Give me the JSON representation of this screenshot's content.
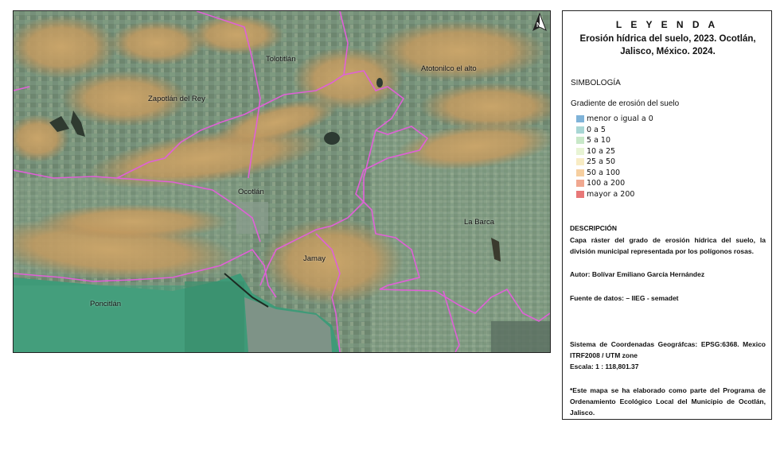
{
  "map": {
    "labels": {
      "tolotitlan": "Tolotitlán",
      "atotonilco": "Atotonilco el alto",
      "zapotlan": "Zapotlán del Rey",
      "ocotlan": "Ocotlán",
      "la_barca": "La Barca",
      "jamay": "Jamay",
      "poncitlan": "Poncitlán"
    },
    "north_arrow_label": "N",
    "boundary_color": "#e060d8"
  },
  "legend": {
    "heading": "L E Y E N D A",
    "title": "Erosión hídrica del suelo, 2023.  Ocotlán, Jalisco, México.  2024.",
    "simbologia": "SIMBOLOGÍA",
    "gradient_title": "Gradiente de erosión del suelo",
    "classes": [
      {
        "label": "menor o igual a 0",
        "color": "#7fb3d8"
      },
      {
        "label": "0 a 5",
        "color": "#a8d6d4"
      },
      {
        "label": "5 a 10",
        "color": "#c8e8c8"
      },
      {
        "label": "10 a 25",
        "color": "#e8f4d4"
      },
      {
        "label": "25 a 50",
        "color": "#f8ecc4"
      },
      {
        "label": "50 a 100",
        "color": "#f6cfa0"
      },
      {
        "label": "100 a 200",
        "color": "#f0a890"
      },
      {
        "label": "mayor a 200",
        "color": "#e87878"
      }
    ],
    "descripcion_heading": "DESCRIPCIÓN",
    "descripcion": "Capa ráster del grado de erosión hídrica del suelo, la división municipal representada por los polígonos rosas.",
    "autor": "Autor: Bolívar Emiliano García Hernández",
    "fuente": "Fuente de datos: – IIEG - semadet",
    "sistema": "Sistema de Coordenadas Geográfcas: EPSG:6368. Mexico ITRF2008 / UTM zone",
    "escala": "Escala: 1 : 118,801.37",
    "nota": "*Este mapa se ha elaborado como parte del Programa de Ordenamiento Ecológico Local del Municipio de Ocotlán, Jalisco."
  }
}
